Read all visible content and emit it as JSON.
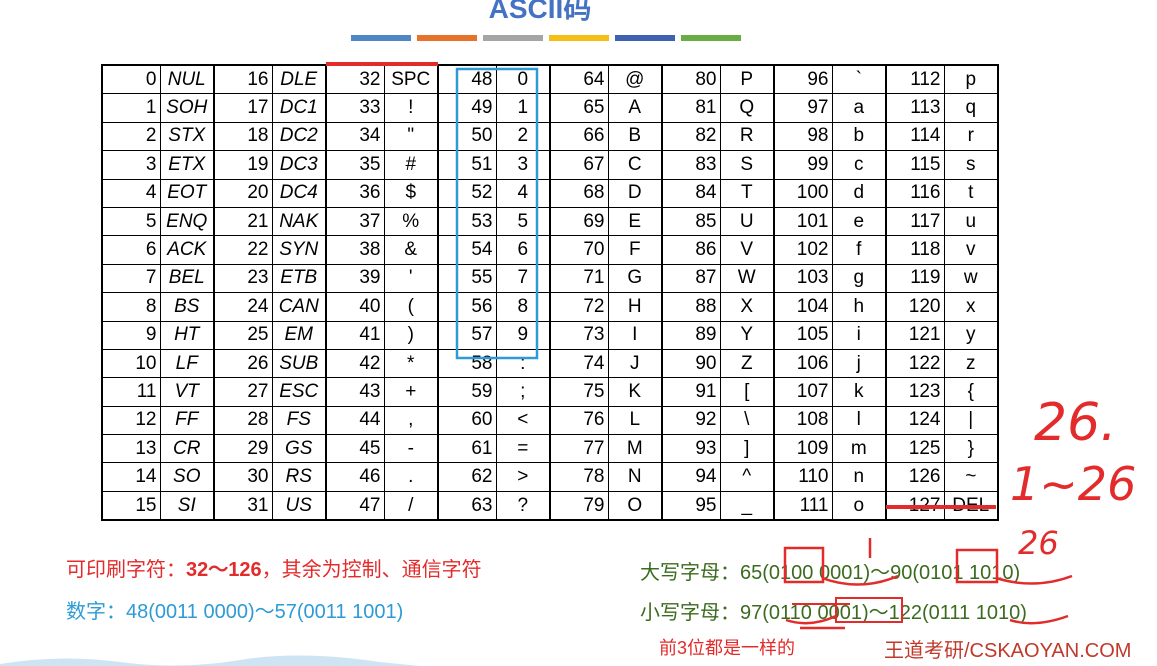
{
  "title": "ASCII码",
  "color_strip": [
    "#4f86c6",
    "#e5732c",
    "#a5a5a5",
    "#f5bf16",
    "#3f61b0",
    "#6aad44"
  ],
  "table": {
    "columns": [
      {
        "codes": [
          "0",
          "1",
          "2",
          "3",
          "4",
          "5",
          "6",
          "7",
          "8",
          "9",
          "10",
          "11",
          "12",
          "13",
          "14",
          "15"
        ],
        "chars": [
          "NUL",
          "SOH",
          "STX",
          "ETX",
          "EOT",
          "ENQ",
          "ACK",
          "BEL",
          "BS",
          "HT",
          "LF",
          "VT",
          "FF",
          "CR",
          "SO",
          "SI"
        ]
      },
      {
        "codes": [
          "16",
          "17",
          "18",
          "19",
          "20",
          "21",
          "22",
          "23",
          "24",
          "25",
          "26",
          "27",
          "28",
          "29",
          "30",
          "31"
        ],
        "chars": [
          "DLE",
          "DC1",
          "DC2",
          "DC3",
          "DC4",
          "NAK",
          "SYN",
          "ETB",
          "CAN",
          "EM",
          "SUB",
          "ESC",
          "FS",
          "GS",
          "RS",
          "US"
        ]
      },
      {
        "codes": [
          "32",
          "33",
          "34",
          "35",
          "36",
          "37",
          "38",
          "39",
          "40",
          "41",
          "42",
          "43",
          "44",
          "45",
          "46",
          "47"
        ],
        "chars": [
          "SPC",
          "!",
          "\"",
          "#",
          "$",
          "%",
          "&",
          "'",
          "(",
          ")",
          "*",
          "+",
          ",",
          "-",
          ".",
          "/"
        ]
      },
      {
        "codes": [
          "48",
          "49",
          "50",
          "51",
          "52",
          "53",
          "54",
          "55",
          "56",
          "57",
          "58",
          "59",
          "60",
          "61",
          "62",
          "63"
        ],
        "chars": [
          "0",
          "1",
          "2",
          "3",
          "4",
          "5",
          "6",
          "7",
          "8",
          "9",
          ":",
          ";",
          "<",
          "=",
          ">",
          "?"
        ]
      },
      {
        "codes": [
          "64",
          "65",
          "66",
          "67",
          "68",
          "69",
          "70",
          "71",
          "72",
          "73",
          "74",
          "75",
          "76",
          "77",
          "78",
          "79"
        ],
        "chars": [
          "@",
          "A",
          "B",
          "C",
          "D",
          "E",
          "F",
          "G",
          "H",
          "I",
          "J",
          "K",
          "L",
          "M",
          "N",
          "O"
        ]
      },
      {
        "codes": [
          "80",
          "81",
          "82",
          "83",
          "84",
          "85",
          "86",
          "87",
          "88",
          "89",
          "90",
          "91",
          "92",
          "93",
          "94",
          "95"
        ],
        "chars": [
          "P",
          "Q",
          "R",
          "S",
          "T",
          "U",
          "V",
          "W",
          "X",
          "Y",
          "Z",
          "[",
          "\\",
          "]",
          "^",
          "_"
        ]
      },
      {
        "codes": [
          "96",
          "97",
          "98",
          "99",
          "100",
          "101",
          "102",
          "103",
          "104",
          "105",
          "106",
          "107",
          "108",
          "109",
          "110",
          "111"
        ],
        "chars": [
          "`",
          "a",
          "b",
          "c",
          "d",
          "e",
          "f",
          "g",
          "h",
          "i",
          "j",
          "k",
          "l",
          "m",
          "n",
          "o"
        ]
      },
      {
        "codes": [
          "112",
          "113",
          "114",
          "115",
          "116",
          "117",
          "118",
          "119",
          "120",
          "121",
          "122",
          "123",
          "124",
          "125",
          "126",
          "127"
        ],
        "chars": [
          "p",
          "q",
          "r",
          "s",
          "t",
          "u",
          "v",
          "w",
          "x",
          "y",
          "z",
          "{",
          "|",
          "}",
          "~",
          "DEL"
        ]
      }
    ]
  },
  "notes": {
    "printable_prefix": "可印刷字符：",
    "printable_range": "32～126",
    "printable_suffix": "，其余为控制、通信字符",
    "digits": "数字：48(0011 0000)～57(0011 1001)",
    "uppercase": "大写字母：65(0100 0001)～90(0101 1010)",
    "lowercase": "小写字母：97(0110 0001)～122(0111 1010)",
    "prefix_same": "前3位都是一样的",
    "brand": "王道考研/CSKAOYAN.COM"
  },
  "handwriting": {
    "annotation_1": "26.",
    "annotation_2": "1~26",
    "annotation_3": "26"
  },
  "colors": {
    "accent_red": "#e32b2b",
    "digits_blue": "#2e9ad6",
    "letters_green": "#3a6b1e",
    "title_blue": "#4472c4"
  }
}
